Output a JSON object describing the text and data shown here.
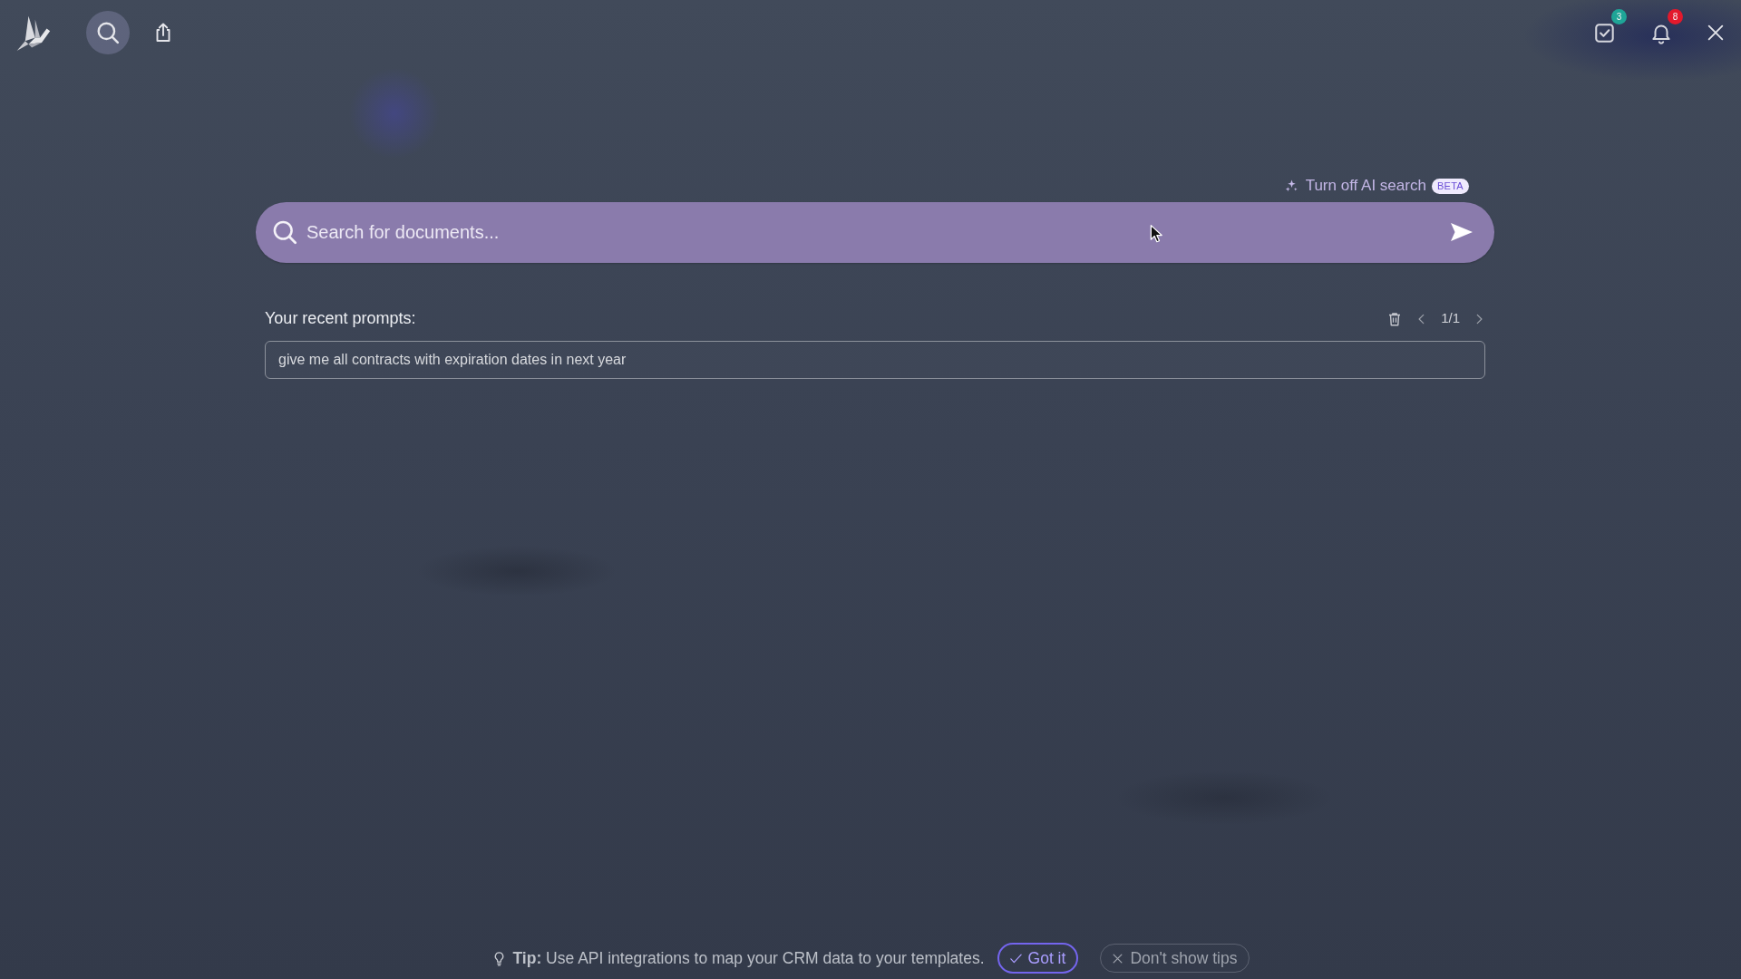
{
  "top_bar": {
    "tools": [
      {
        "kind": "search",
        "selected": true
      },
      {
        "kind": "share",
        "selected": false
      }
    ],
    "indicators": [
      {
        "kind": "tasks",
        "badge": "3",
        "color": "#1fa597"
      },
      {
        "kind": "notifications",
        "badge": "8",
        "color": "#e3192c"
      }
    ]
  },
  "ai_toggle": {
    "label": "Turn off AI search",
    "badge": "BETA"
  },
  "search": {
    "placeholder": "Search for documents..."
  },
  "recent_prompts": {
    "title": "Your recent prompts:",
    "page": "1/1",
    "items": [
      "give me all contracts with expiration dates in next year"
    ]
  },
  "tip": {
    "text": "**Tip:** Use API integrations to map your CRM data to your templates.",
    "buttons": [
      {
        "kind": "confirm",
        "label": "Got it"
      },
      {
        "kind": "dismiss",
        "label": "Don't show tips"
      }
    ]
  }
}
